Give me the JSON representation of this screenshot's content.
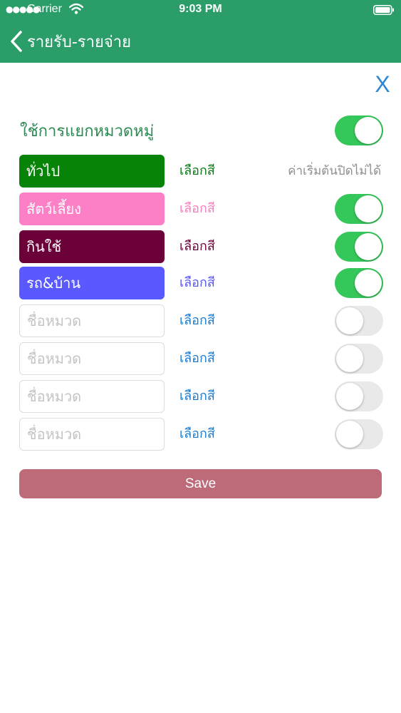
{
  "status_bar": {
    "carrier": "Carrier",
    "time": "9:03 PM"
  },
  "nav": {
    "back_label": "รายรับ-รายจ่าย"
  },
  "close_label": "X",
  "use_categories": {
    "label": "ใช้การแยกหมวดหมู่",
    "enabled": true
  },
  "categories": [
    {
      "name": "ทั่วไป",
      "placeholder": "",
      "color": "#078307",
      "pick_label": "เลือกสี",
      "pick_color": "#0a7a17",
      "note": "ค่าเริ่มต้นปิดไม่ได้",
      "enabled": true
    },
    {
      "name": "สัตว์เลี้ยง",
      "placeholder": "",
      "color": "#fd7fc5",
      "pick_label": "เลือกสี",
      "pick_color": "#f57fbe",
      "note": "",
      "enabled": true
    },
    {
      "name": "กินใช้",
      "placeholder": "",
      "color": "#6c0038",
      "pick_label": "เลือกสี",
      "pick_color": "#6c0038",
      "note": "",
      "enabled": true
    },
    {
      "name": "รถ&บ้าน",
      "placeholder": "",
      "color": "#5959ff",
      "pick_label": "เลือกสี",
      "pick_color": "#5858ee",
      "note": "",
      "enabled": true
    },
    {
      "name": "",
      "placeholder": "ชื่อหมวด",
      "color": "",
      "pick_label": "เลือกสี",
      "pick_color": "#1a7ccf",
      "note": "",
      "enabled": false
    },
    {
      "name": "",
      "placeholder": "ชื่อหมวด",
      "color": "",
      "pick_label": "เลือกสี",
      "pick_color": "#1a7ccf",
      "note": "",
      "enabled": false
    },
    {
      "name": "",
      "placeholder": "ชื่อหมวด",
      "color": "",
      "pick_label": "เลือกสี",
      "pick_color": "#1a7ccf",
      "note": "",
      "enabled": false
    },
    {
      "name": "",
      "placeholder": "ชื่อหมวด",
      "color": "",
      "pick_label": "เลือกสี",
      "pick_color": "#1a7ccf",
      "note": "",
      "enabled": false
    }
  ],
  "save_label": "Save"
}
